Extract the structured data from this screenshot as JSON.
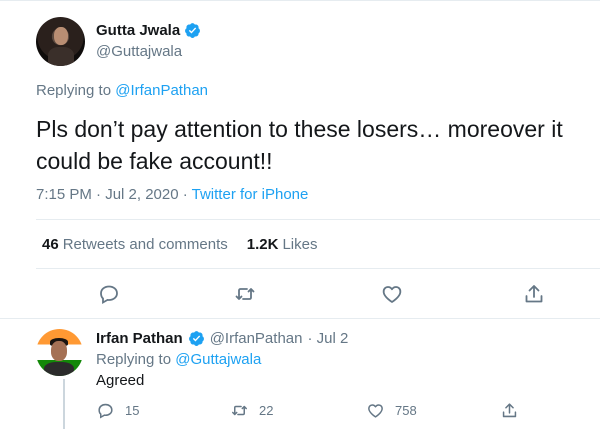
{
  "main_tweet": {
    "author_name": "Gutta Jwala",
    "author_handle": "@Guttajwala",
    "replying_prefix": "Replying to ",
    "replying_to": "@IrfanPathan",
    "text": "Pls don’t pay attention to these losers… moreover it could be fake account!!",
    "timestamp": "7:15 PM · Jul 2, 2020 · ",
    "source": "Twitter for iPhone",
    "stats": {
      "retweets_count": "46",
      "retweets_label": "Retweets and comments",
      "likes_count": "1.2K",
      "likes_label": "Likes"
    },
    "actions": [
      "reply-icon",
      "retweet-icon",
      "like-icon",
      "share-icon"
    ]
  },
  "reply_tweet": {
    "author_name": "Irfan Pathan",
    "author_handle": "@IrfanPathan",
    "date": "· Jul 2",
    "replying_prefix": "Replying to ",
    "replying_to": "@Guttajwala",
    "text": "Agreed",
    "reply_count": "15",
    "retweet_count": "22",
    "like_count": "758"
  },
  "colors": {
    "accent": "#1da1f2",
    "secondary_text": "#657786",
    "primary_text": "#14171a",
    "border": "#e6ecf0"
  }
}
